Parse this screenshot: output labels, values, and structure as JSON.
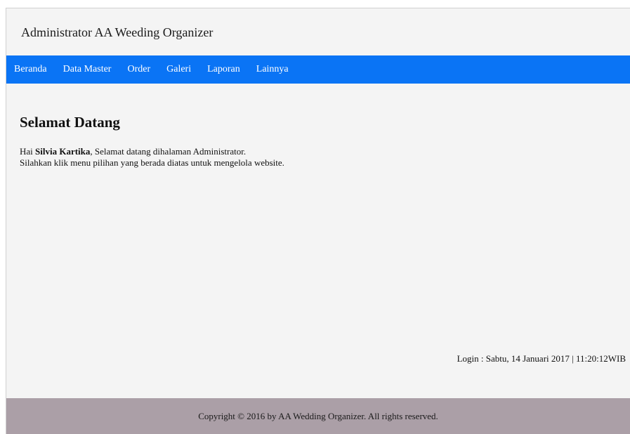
{
  "header": {
    "title": "Administrator AA Weeding Organizer"
  },
  "nav": {
    "items": [
      {
        "label": "Beranda"
      },
      {
        "label": "Data Master"
      },
      {
        "label": "Order"
      },
      {
        "label": "Galeri"
      },
      {
        "label": "Laporan"
      },
      {
        "label": "Lainnya"
      }
    ]
  },
  "main": {
    "heading": "Selamat Datang",
    "greeting_prefix": "Hai ",
    "user_name": "Silvia Kartika",
    "greeting_suffix": ", Selamat datang dihalaman Administrator.",
    "instruction": "Silahkan klik menu pilihan yang berada diatas untuk mengelola website.",
    "login_info": "Login : Sabtu, 14 Januari 2017 | 11:20:12WIB"
  },
  "footer": {
    "copyright": "Copyright © 2016 by AA Wedding Organizer. All rights reserved."
  },
  "colors": {
    "navbar": "#0a74f5",
    "footer": "#ab9fa7",
    "page_background": "#f4f4f4"
  }
}
